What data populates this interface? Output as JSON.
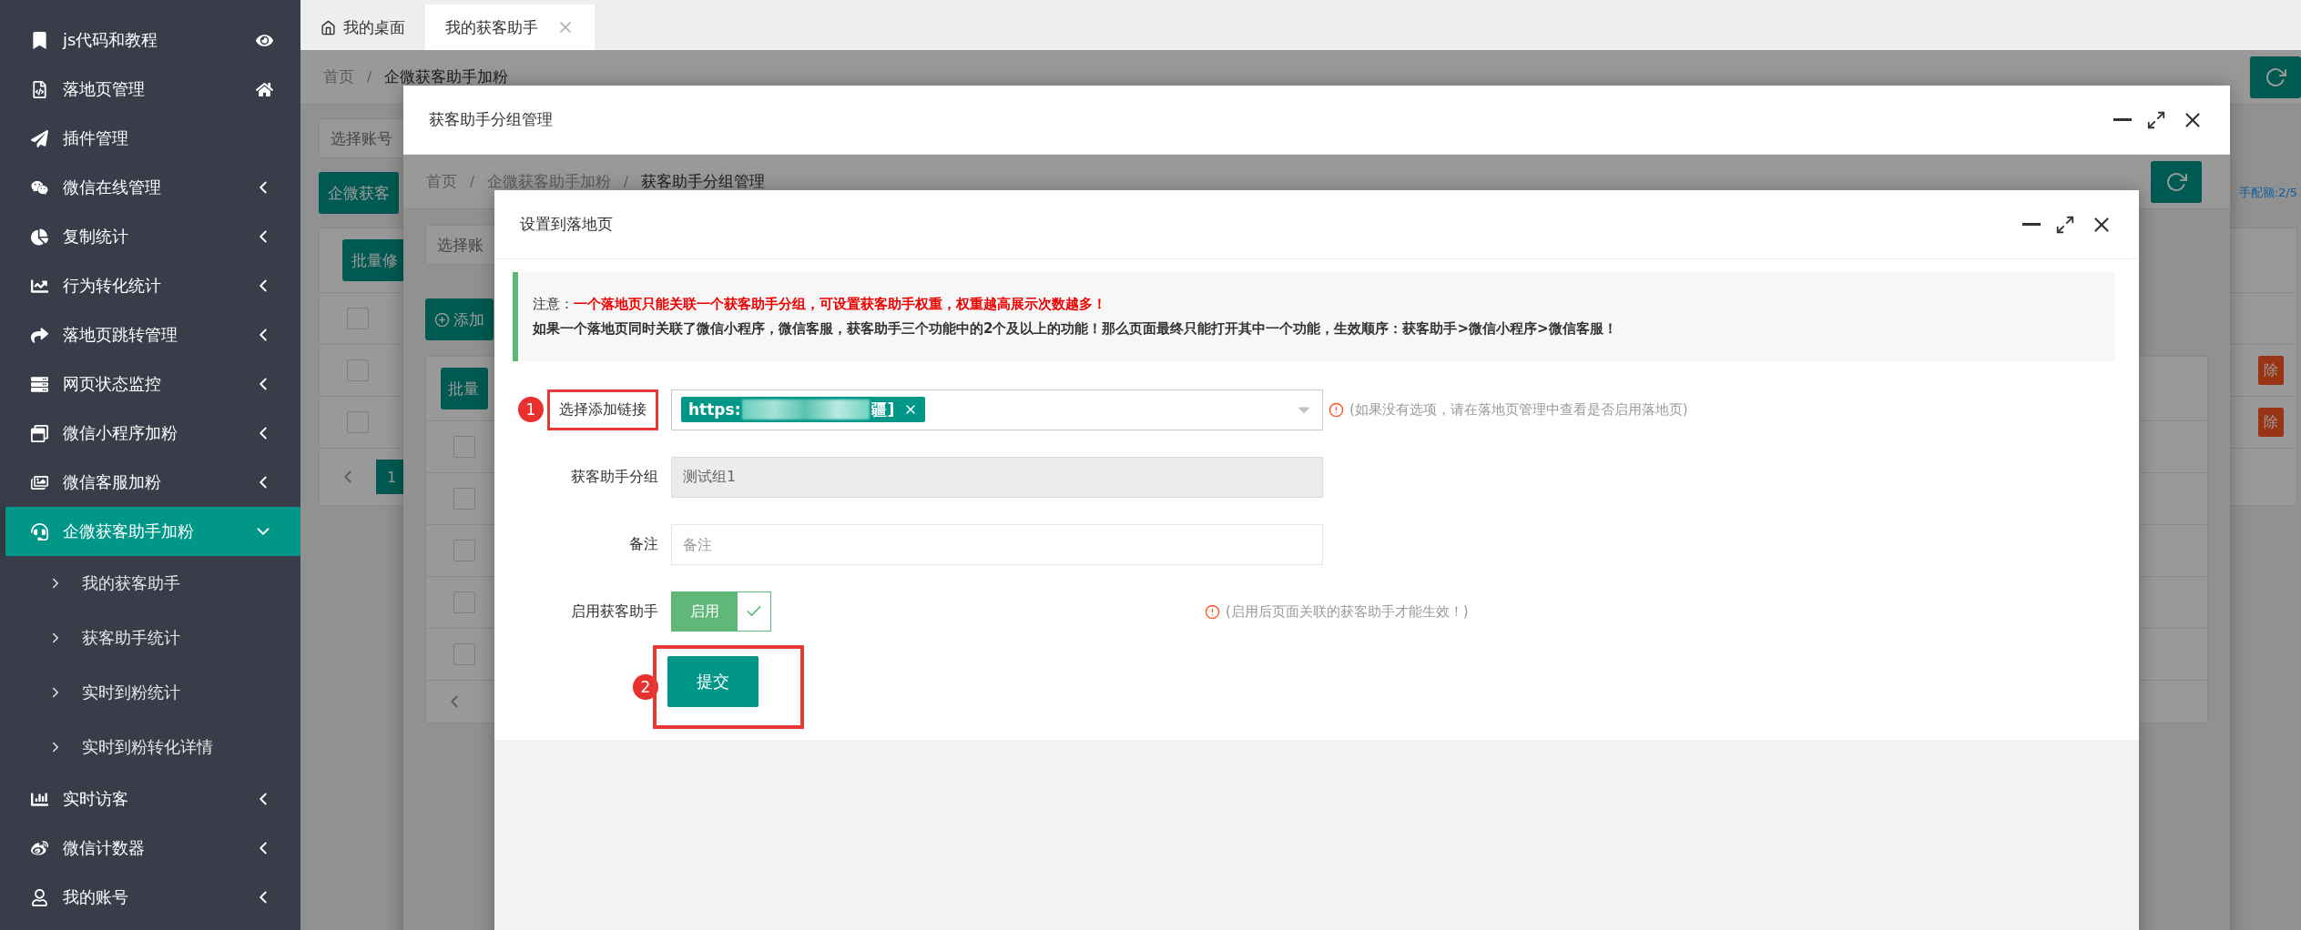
{
  "sidebar": {
    "items": [
      {
        "label": "js代码和教程",
        "selected": false
      },
      {
        "label": "落地页管理",
        "selected": false
      },
      {
        "label": "插件管理",
        "selected": false
      },
      {
        "label": "微信在线管理",
        "selected": false,
        "expanded": false
      },
      {
        "label": "复制统计",
        "selected": false,
        "expanded": false
      },
      {
        "label": "行为转化统计",
        "selected": false,
        "expanded": false
      },
      {
        "label": "落地页跳转管理",
        "selected": false,
        "expanded": false
      },
      {
        "label": "网页状态监控",
        "selected": false,
        "expanded": false
      },
      {
        "label": "微信小程序加粉",
        "selected": false,
        "expanded": false
      },
      {
        "label": "微信客服加粉",
        "selected": false,
        "expanded": false
      },
      {
        "label": "企微获客助手加粉",
        "selected": true,
        "expanded": true,
        "children": [
          {
            "label": "我的获客助手",
            "selected": false
          },
          {
            "label": "获客助手统计",
            "selected": false
          },
          {
            "label": "实时到粉统计",
            "selected": false
          },
          {
            "label": "实时到粉转化详情",
            "selected": false
          }
        ]
      },
      {
        "label": "实时访客",
        "selected": false,
        "expanded": false
      },
      {
        "label": "微信计数器",
        "selected": false,
        "expanded": false
      },
      {
        "label": "我的账号",
        "selected": false,
        "expanded": false
      }
    ]
  },
  "tabs": [
    {
      "label": "我的桌面",
      "selected": false
    },
    {
      "label": "我的获客助手",
      "selected": true
    }
  ],
  "page": {
    "breadcrumb": [
      "首页",
      "企微获客助手加粉"
    ],
    "breadcrumb_separator": "/",
    "account_select": {
      "placeholder": "选择账号"
    },
    "primary_button": "企微获客",
    "quota_text": "手配额:2/5",
    "batch_button": "批量修",
    "rows": [
      {
        "checked": false,
        "delete_button": null
      },
      {
        "checked": false,
        "delete_button": "除"
      },
      {
        "checked": false,
        "delete_button": "除"
      }
    ],
    "page_number": "1"
  },
  "dialog_1": {
    "title": "获客助手分组管理",
    "breadcrumb": [
      "首页",
      "企微获客助手加粉",
      "获客助手分组管理"
    ],
    "breadcrumb_separator": "/",
    "account_select": {
      "placeholder": "选择账"
    },
    "add_button": "添加",
    "batch_button": "批量",
    "rows": [
      {
        "checked": false
      },
      {
        "checked": false
      },
      {
        "checked": false
      },
      {
        "checked": false
      },
      {
        "checked": false
      }
    ]
  },
  "dialog_2": {
    "title": "设置到落地页",
    "notice": {
      "prefix": "注意：",
      "emphasis": "一个落地页只能关联一个获客助手分组，可设置获客助手权重，权重越高展示次数越多！",
      "body": "如果一个落地页同时关联了微信小程序，微信客服，获客助手三个功能中的2个及以上的功能！那么页面最终只能打开其中一个功能，生效顺序：获客助手>微信小程序>微信客服！"
    },
    "fields": [
      {
        "kind": "tag_select",
        "label": "选择添加链接",
        "marker": "1",
        "highlighted": true,
        "tag_start": "https:",
        "tag_end": "疆]",
        "hint": "(如果没有选项，请在落地页管理中查看是否启用落地页)"
      },
      {
        "kind": "input",
        "label": "获客助手分组",
        "highlighted": false,
        "value": "测试组1",
        "disabled": true
      },
      {
        "kind": "input",
        "label": "备注",
        "highlighted": false,
        "placeholder": "备注",
        "disabled": false
      },
      {
        "kind": "switch",
        "label": "启用获客助手",
        "highlighted": false,
        "on": true,
        "on_text": "启用",
        "hint": "(启用后页面关联的获客助手才能生效！)"
      }
    ],
    "submit": {
      "label": "提交",
      "marker": "2",
      "highlighted": true
    }
  }
}
